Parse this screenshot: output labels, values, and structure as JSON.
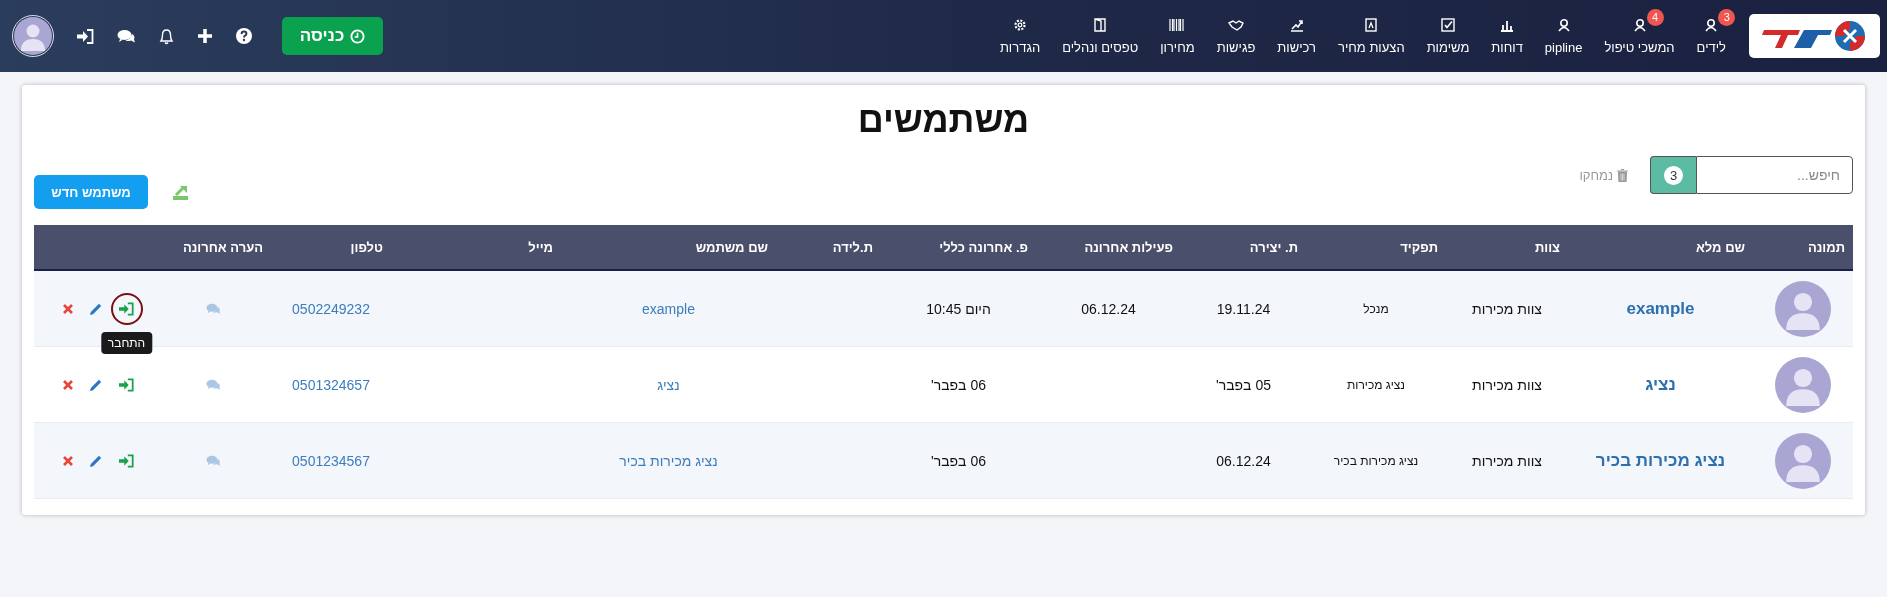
{
  "nav": {
    "items": [
      {
        "label": "לידים",
        "badge": "3"
      },
      {
        "label": "המשכי טיפול",
        "badge": "4"
      },
      {
        "label": "pipline"
      },
      {
        "label": "דוחות"
      },
      {
        "label": "משימות"
      },
      {
        "label": "הצעות מחיר"
      },
      {
        "label": "רכישות"
      },
      {
        "label": "פגישות"
      },
      {
        "label": "מחירון"
      },
      {
        "label": "טפסים ונהלים"
      },
      {
        "label": "הגדרות"
      }
    ],
    "clock_button": "כניסה"
  },
  "title": "משתמשים",
  "search": {
    "placeholder": "חיפש...",
    "count": "3"
  },
  "deleted_link": "נמחקו",
  "new_user_button": "משתמש חדש",
  "table": {
    "columns": [
      "תמונה",
      "שם מלא",
      "צוות",
      "תפקיד",
      "ת. יצירה",
      "פעילות אחרונה",
      "פ. אחרונה כללי",
      "ת.לידה",
      "שם משתמש",
      "מייל",
      "טלפון",
      "הערה אחרונה"
    ],
    "rows": [
      {
        "full_name": "example",
        "team": "צוות מכירות",
        "role": "מנכל",
        "created": "19.11.24",
        "last_activity": "06.12.24",
        "last_general": "היום 10:45",
        "username": "example",
        "phone": "0502249232",
        "highlighted": true,
        "tooltip": "התחבר"
      },
      {
        "full_name": "נציג",
        "team": "צוות מכירות",
        "role": "נציג מכירות",
        "created": "05 בפבר'",
        "last_general": "06 בפבר'",
        "username": "נציג",
        "phone": "0501324657",
        "highlighted": false
      },
      {
        "full_name": "נציג מכירות בכיר",
        "team": "צוות מכירות",
        "role": "נציג מכירות בכיר",
        "created": "06.12.24",
        "last_general": "06 בפבר'",
        "username": "נציג מכירות בכיר",
        "phone": "0501234567",
        "highlighted": false
      }
    ]
  }
}
